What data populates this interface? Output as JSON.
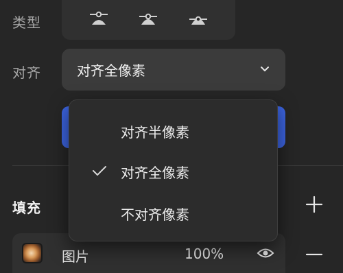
{
  "panel": {
    "type_label": "类型",
    "align_label": "对齐",
    "type_buttons": [
      {
        "icon": "align-top-anchor-icon"
      },
      {
        "icon": "align-center-anchor-icon"
      },
      {
        "icon": "align-bottom-anchor-icon"
      }
    ],
    "align_select": {
      "value": "对齐全像素",
      "icon": "chevron-down-icon"
    },
    "fill_label": "填充",
    "add_icon": "plus-icon",
    "remove_icon": "minus-icon",
    "fill_item": {
      "name": "图片",
      "opacity": "100%",
      "visibility_icon": "eye-icon"
    }
  },
  "dropdown": {
    "options": [
      {
        "label": "对齐半像素",
        "selected": false
      },
      {
        "label": "对齐全像素",
        "selected": true
      },
      {
        "label": "不对齐像素",
        "selected": false
      }
    ],
    "check_icon": "checkmark-icon"
  },
  "colors": {
    "background": "#262626",
    "accent": "#3c64e0",
    "menu_background": "#2c2c2c"
  }
}
